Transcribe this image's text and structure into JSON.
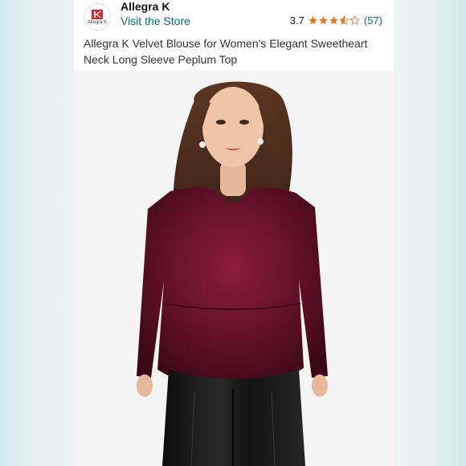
{
  "store": {
    "brand_name": "Allegra K",
    "logo_text": "Allegra K",
    "visit_link": "Visit the Store",
    "logo_icon": "allegra-k-logo-icon"
  },
  "rating": {
    "value": "3.7",
    "stars": 3.7,
    "review_count": "(57)",
    "star_color": "#de7921"
  },
  "product": {
    "title": "Allegra K Velvet Blouse for Women's Elegant Sweetheart Neck Long Sleeve Peplum Top",
    "image_alt": "model-wearing-burgundy-velvet-peplum-top"
  },
  "colors": {
    "link": "#007185",
    "velvet": "#5e0f22",
    "background": "#eef4f2"
  }
}
